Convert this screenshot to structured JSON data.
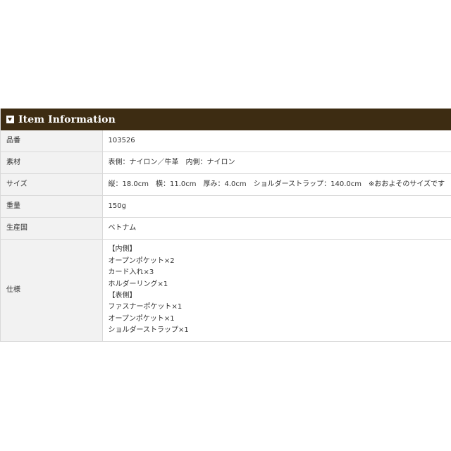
{
  "header": {
    "title": "Item Information",
    "toggle_icon": "caret-down-square-icon"
  },
  "rows": [
    {
      "label": "品番",
      "value": "103526"
    },
    {
      "label": "素材",
      "value": "表側：ナイロン／牛革　内側：ナイロン"
    },
    {
      "label": "サイズ",
      "value": "縦：18.0cm　横：11.0cm　厚み：4.0cm　ショルダーストラップ：140.0cm　※おおよそのサイズです"
    },
    {
      "label": "重量",
      "value": "150g"
    },
    {
      "label": "生産国",
      "value": "ベトナム"
    }
  ],
  "spec": {
    "label": "仕様",
    "lines": [
      "【内側】",
      "オープンポケット×2",
      "カード入れ×3",
      "ホルダーリング×1",
      "【表側】",
      "ファスナーポケット×1",
      "オープンポケット×1",
      "ショルダーストラップ×1"
    ]
  },
  "colors": {
    "header_bg": "#3d2c12",
    "label_bg": "#f2f2f2",
    "border": "#d9d9d9"
  }
}
